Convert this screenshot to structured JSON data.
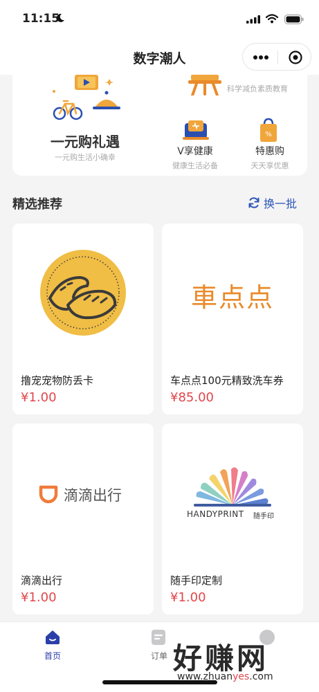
{
  "status": {
    "time": "11:15"
  },
  "nav": {
    "title": "数字潮人"
  },
  "promo": {
    "main": {
      "title": "一元购礼遇",
      "subtitle": "一元购生活小确幸"
    },
    "education": {
      "subtitle": "科学减负素质教育"
    },
    "items": [
      {
        "title": "V享健康",
        "subtitle": "健康生活必备"
      },
      {
        "title": "特惠购",
        "subtitle": "天天享优惠"
      }
    ]
  },
  "section": {
    "title": "精选推荐",
    "refresh_label": "换一批"
  },
  "products": [
    {
      "name": "撸宠宠物防丢卡",
      "price": "¥1.00",
      "image": "pet-tag-logo"
    },
    {
      "name": "车点点100元精致洗车券",
      "price": "¥85.00",
      "image": "chediandian-logo",
      "logo_text": "車点点"
    },
    {
      "name": "滴滴出行",
      "price": "¥1.00",
      "image": "didi-logo",
      "logo_text": "滴滴出行"
    },
    {
      "name": "随手印定制",
      "price": "¥1.00",
      "image": "handyprint-logo",
      "logo_text": "HANDYPRINT",
      "logo_sub": "随手印"
    }
  ],
  "tabs": [
    {
      "label": "首页",
      "active": true
    },
    {
      "label": "订单",
      "active": false
    },
    {
      "label": "",
      "active": false
    }
  ],
  "watermark": {
    "main": "好赚网",
    "url_prefix": "www.zhuan",
    "url_highlight": "yes",
    "url_suffix": ".com"
  },
  "colors": {
    "accent": "#2b55b8",
    "price": "#e0474c",
    "orange": "#e98a2a",
    "gold": "#f0bd45"
  }
}
